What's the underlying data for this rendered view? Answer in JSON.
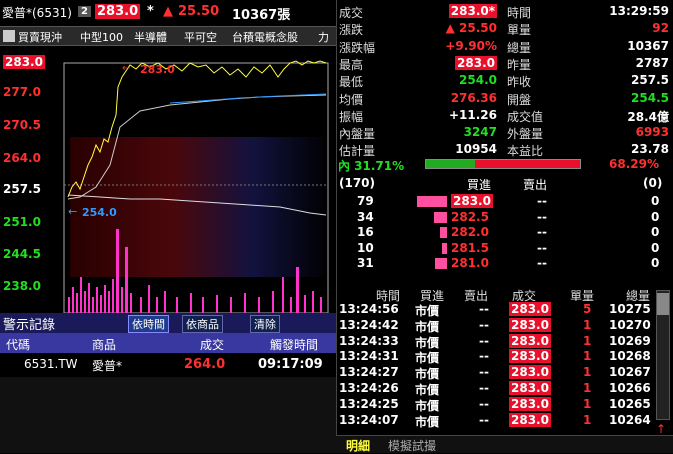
{
  "top": {
    "name": "愛普*(6531)",
    "badge": "2",
    "price": "283.0",
    "star": "*",
    "arrow": "▲",
    "change": "25.50",
    "volume": "10367張"
  },
  "menu": [
    "買賣現沖",
    "中型100",
    "半導體",
    "平可空",
    "台積電概念股",
    "力"
  ],
  "chart": {
    "y_ticks": [
      "283.0",
      "277.0",
      "270.5",
      "264.0",
      "257.5",
      "251.0",
      "244.5",
      "238.0"
    ],
    "high_marker": "283.0",
    "low_marker": "254.0"
  },
  "alert": {
    "title": "警示記錄",
    "tab_time": "依時間",
    "tab_product": "依商品",
    "tab_clear": "清除",
    "cols": [
      "代碼",
      "商品",
      "成交",
      "觸發時間"
    ],
    "row": {
      "code": "6531.TW",
      "name": "愛普*",
      "price": "264.0",
      "time": "09:17:09"
    }
  },
  "quote": {
    "left": [
      {
        "label": "成交",
        "value": "283.0*"
      },
      {
        "label": "漲跌",
        "value": "▲ 25.50"
      },
      {
        "label": "漲跌幅",
        "value": "+9.90%"
      },
      {
        "label": "最高",
        "value": "283.0"
      },
      {
        "label": "最低",
        "value": "254.0"
      },
      {
        "label": "均價",
        "value": "276.36"
      },
      {
        "label": "振幅",
        "value": "+11.26"
      },
      {
        "label": "內盤量",
        "value": "3247"
      },
      {
        "label": "估計量",
        "value": "10954"
      }
    ],
    "right": [
      {
        "label": "時間",
        "value": "13:29:59"
      },
      {
        "label": "單量",
        "value": "92"
      },
      {
        "label": "總量",
        "value": "10367"
      },
      {
        "label": "昨量",
        "value": "2787"
      },
      {
        "label": "昨收",
        "value": "257.5"
      },
      {
        "label": "開盤",
        "value": "254.5"
      },
      {
        "label": "成交值",
        "value": "28.4億"
      },
      {
        "label": "外盤量",
        "value": "6993"
      },
      {
        "label": "本益比",
        "value": "23.78"
      }
    ],
    "inner_pct": "內 31.71%",
    "outer_pct": "68.29%",
    "inner_ratio": 0.3171
  },
  "book": {
    "left_count": "(170)",
    "bid_label": "買進",
    "ask_label": "賣出",
    "right_count": "(0)",
    "rows": [
      {
        "qty": "79",
        "price": "283.0",
        "ask": "--",
        "askqty": "0",
        "bar": 0.5
      },
      {
        "qty": "34",
        "price": "282.5",
        "ask": "--",
        "askqty": "0",
        "bar": 0.22
      },
      {
        "qty": "16",
        "price": "282.0",
        "ask": "--",
        "askqty": "0",
        "bar": 0.12
      },
      {
        "qty": "10",
        "price": "281.5",
        "ask": "--",
        "askqty": "0",
        "bar": 0.08
      },
      {
        "qty": "31",
        "price": "281.0",
        "ask": "--",
        "askqty": "0",
        "bar": 0.2
      }
    ]
  },
  "ticks": {
    "headers": [
      "時間",
      "買進",
      "賣出",
      "成交",
      "單量",
      "總量"
    ],
    "rows": [
      {
        "time": "13:24:56",
        "bid": "市價",
        "ask": "--",
        "price": "283.0",
        "qty": "5",
        "total": "10275"
      },
      {
        "time": "13:24:42",
        "bid": "市價",
        "ask": "--",
        "price": "283.0",
        "qty": "1",
        "total": "10270"
      },
      {
        "time": "13:24:33",
        "bid": "市價",
        "ask": "--",
        "price": "283.0",
        "qty": "1",
        "total": "10269"
      },
      {
        "time": "13:24:31",
        "bid": "市價",
        "ask": "--",
        "price": "283.0",
        "qty": "1",
        "total": "10268"
      },
      {
        "time": "13:24:27",
        "bid": "市價",
        "ask": "--",
        "price": "283.0",
        "qty": "1",
        "total": "10267"
      },
      {
        "time": "13:24:26",
        "bid": "市價",
        "ask": "--",
        "price": "283.0",
        "qty": "1",
        "total": "10266"
      },
      {
        "time": "13:24:25",
        "bid": "市價",
        "ask": "--",
        "price": "283.0",
        "qty": "1",
        "total": "10265"
      },
      {
        "time": "13:24:07",
        "bid": "市價",
        "ask": "--",
        "price": "283.0",
        "qty": "1",
        "total": "10264"
      }
    ]
  },
  "tabs": {
    "detail": "明細",
    "sim": "模擬試撮"
  }
}
